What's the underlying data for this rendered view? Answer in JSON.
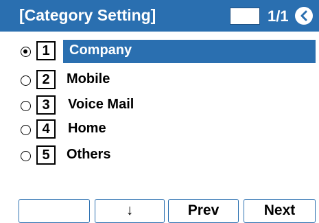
{
  "header": {
    "title": "[Category Setting]",
    "page_indicator": "1/1",
    "back_icon": "return-arrow-icon"
  },
  "items": [
    {
      "number": "1",
      "label": "Company",
      "selected": true
    },
    {
      "number": "2",
      "label": "Mobile",
      "selected": false
    },
    {
      "number": "3",
      "label": "Voice Mail",
      "selected": false
    },
    {
      "number": "4",
      "label": "Home",
      "selected": false
    },
    {
      "number": "5",
      "label": "Others",
      "selected": false
    }
  ],
  "softkeys": {
    "key1": "",
    "key2_icon": "down-arrow-icon",
    "key2": "↓",
    "key3": "Prev",
    "key4": "Next"
  },
  "colors": {
    "accent": "#2a6fb0",
    "background": "#ffffff"
  }
}
